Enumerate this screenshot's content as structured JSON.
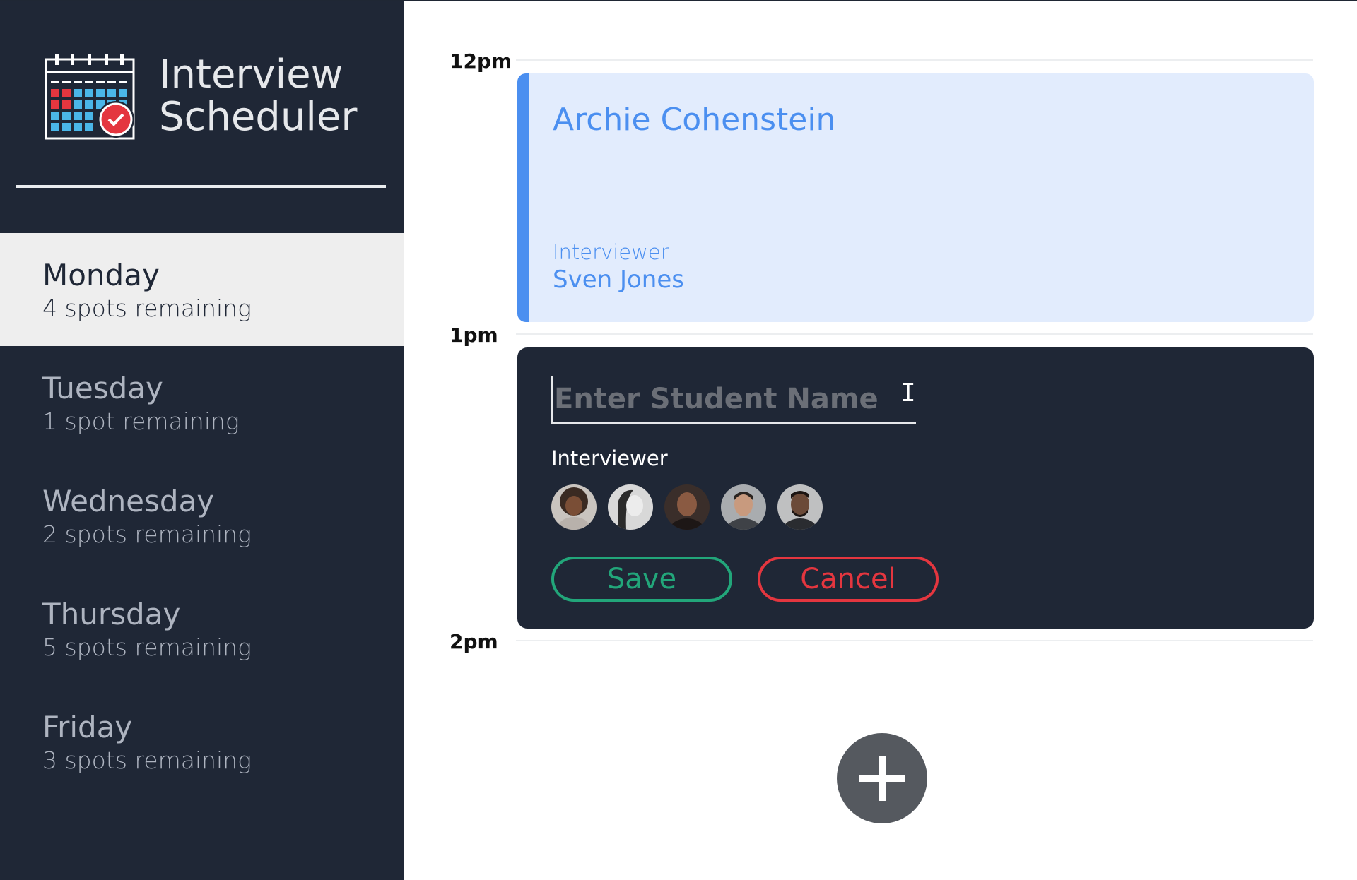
{
  "app": {
    "title_line1": "Interview",
    "title_line2": "Scheduler"
  },
  "days": [
    {
      "name": "Monday",
      "spots": "4 spots remaining",
      "selected": true
    },
    {
      "name": "Tuesday",
      "spots": "1 spot remaining",
      "selected": false
    },
    {
      "name": "Wednesday",
      "spots": "2 spots remaining",
      "selected": false
    },
    {
      "name": "Thursday",
      "spots": "5 spots remaining",
      "selected": false
    },
    {
      "name": "Friday",
      "spots": "3 spots remaining",
      "selected": false
    }
  ],
  "schedule": {
    "times": [
      "12pm",
      "1pm",
      "2pm"
    ],
    "appointment": {
      "student": "Archie Cohenstein",
      "interviewer_label": "Interviewer",
      "interviewer_name": "Sven Jones"
    },
    "form": {
      "student_placeholder": "Enter Student Name",
      "interviewer_label": "Interviewer",
      "save_label": "Save",
      "cancel_label": "Cancel"
    }
  },
  "colors": {
    "sidebar_bg": "#1f2736",
    "selected_day_bg": "#eeeeee",
    "appointment_bg": "#e2ecfd",
    "appointment_accent": "#4b8ff0",
    "save": "#22a67a",
    "cancel": "#e4363f",
    "add_button": "#55595f"
  },
  "icons": {
    "logo": "calendar-check-icon",
    "add": "plus-icon",
    "cursor": "text-cursor-icon"
  }
}
